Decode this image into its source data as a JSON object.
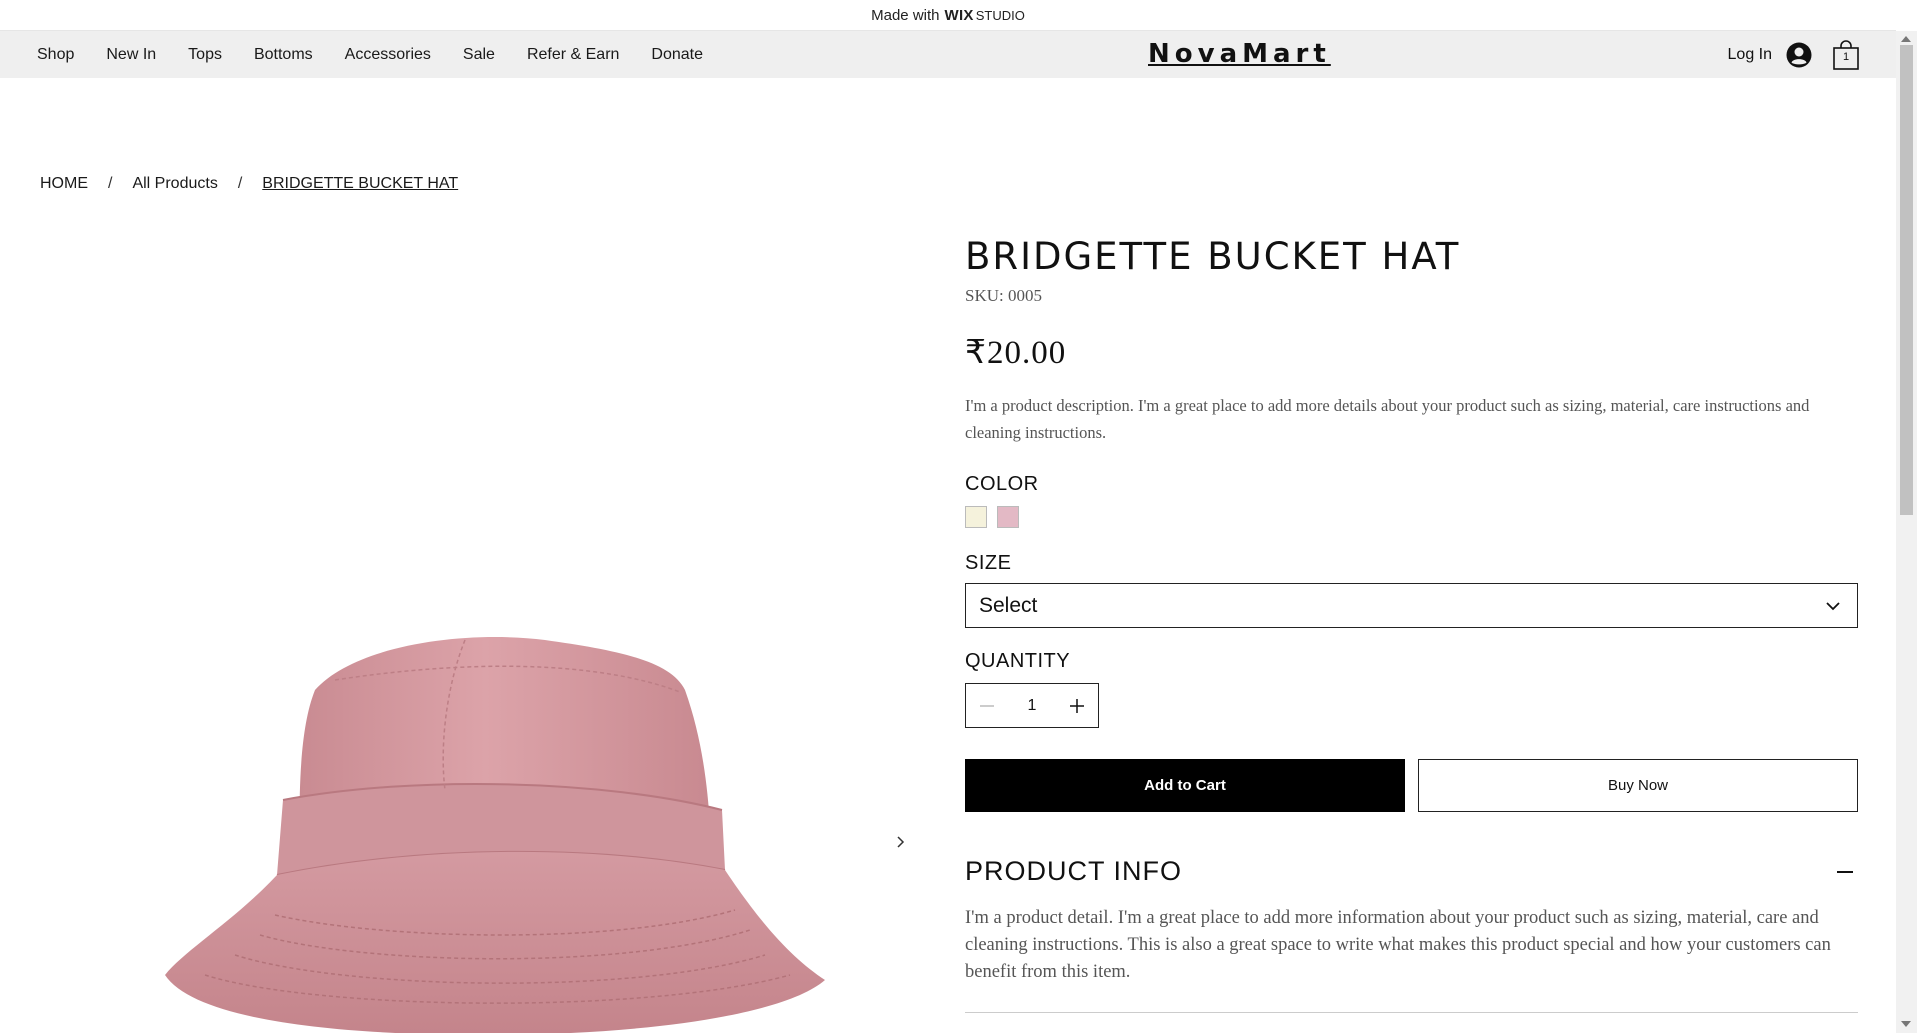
{
  "banner": {
    "prefix": "Made with",
    "brand": "WIX",
    "brand_sub": "STUDIO"
  },
  "header": {
    "nav": [
      "Shop",
      "New In",
      "Tops",
      "Bottoms",
      "Accessories",
      "Sale",
      "Refer & Earn",
      "Donate"
    ],
    "logo": "NovaMart",
    "login": "Log In",
    "cart_count": "1"
  },
  "breadcrumb": {
    "home": "HOME",
    "sep1": "/",
    "all": "All Products",
    "sep2": "/",
    "current": "BRIDGETTE BUCKET HAT"
  },
  "product": {
    "title": "BRIDGETTE BUCKET HAT",
    "sku": "SKU: 0005",
    "price": "₹20.00",
    "description": "I'm a product description. I'm a great place to add more details about your product such as sizing, material, care instructions and cleaning instructions.",
    "color_label": "COLOR",
    "colors": [
      "#f5f2dc",
      "#e3b9c5"
    ],
    "size_label": "SIZE",
    "size_value": "Select",
    "quantity_label": "QUANTITY",
    "quantity": "1",
    "add_to_cart": "Add to Cart",
    "buy_now": "Buy Now",
    "info_title": "PRODUCT INFO",
    "info_text": "I'm a product detail. I'm a great place to add more information about your product such as sizing, material, care and cleaning instructions. This is also a great space to write what makes this product special and how your customers can benefit from this item.",
    "hat_color": "#d9a1a6"
  }
}
